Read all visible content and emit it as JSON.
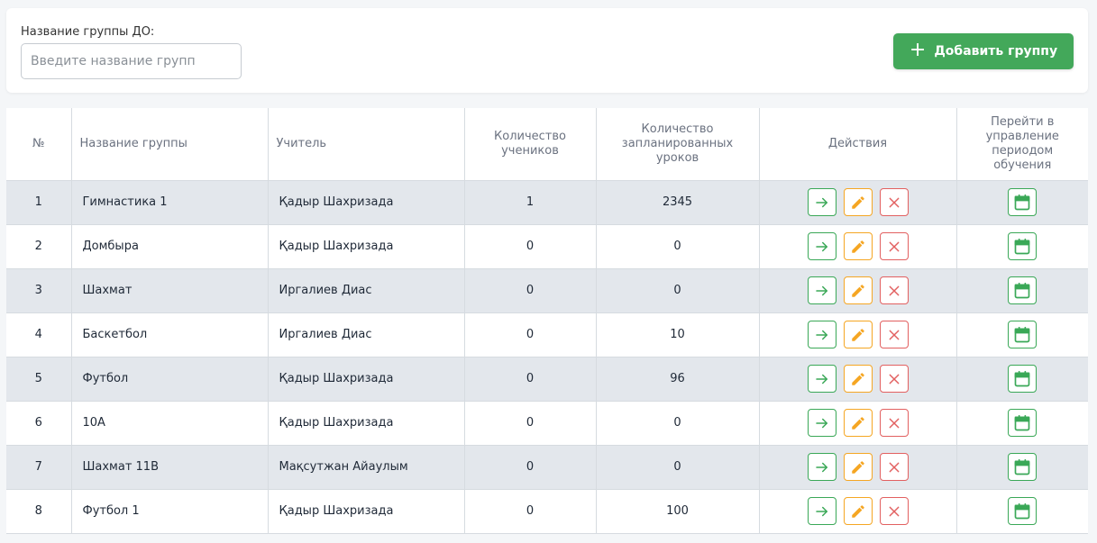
{
  "filter": {
    "label": "Название группы ДО:",
    "placeholder": "Введите название групп"
  },
  "add_button_label": "Добавить группу",
  "table": {
    "columns": {
      "num": "№",
      "name": "Название группы",
      "teacher": "Учитель",
      "students": "Количество учеников",
      "lessons": "Количество запланированных уроков",
      "actions": "Действия",
      "period": "Перейти в управление периодом обучения"
    },
    "rows": [
      {
        "num": "1",
        "name": "Гимнастика 1",
        "teacher": "Қадыр Шахризада",
        "students": "1",
        "lessons": "2345"
      },
      {
        "num": "2",
        "name": "Домбыра",
        "teacher": "Қадыр Шахризада",
        "students": "0",
        "lessons": "0"
      },
      {
        "num": "3",
        "name": "Шахмат",
        "teacher": "Иргалиев Диас",
        "students": "0",
        "lessons": "0"
      },
      {
        "num": "4",
        "name": "Баскетбол",
        "teacher": "Иргалиев Диас",
        "students": "0",
        "lessons": "10"
      },
      {
        "num": "5",
        "name": "Футбол",
        "teacher": "Қадыр Шахризада",
        "students": "0",
        "lessons": "96"
      },
      {
        "num": "6",
        "name": "10А",
        "teacher": "Қадыр Шахризада",
        "students": "0",
        "lessons": "0"
      },
      {
        "num": "7",
        "name": "Шахмат 11В",
        "teacher": "Мақсутжан Айаулым",
        "students": "0",
        "lessons": "0"
      },
      {
        "num": "8",
        "name": "Футбол 1",
        "teacher": "Қадыр Шахризада",
        "students": "0",
        "lessons": "100"
      }
    ]
  },
  "icons": {
    "add": "plus-icon",
    "go": "arrow-right-icon",
    "edit": "pencil-icon",
    "delete": "close-icon",
    "period": "calendar-icon"
  },
  "colors": {
    "primary_green": "#43a85a",
    "action_green": "#3aa857",
    "action_orange": "#f5a623",
    "action_red": "#e26060",
    "row_shade": "#e3e7ec"
  }
}
